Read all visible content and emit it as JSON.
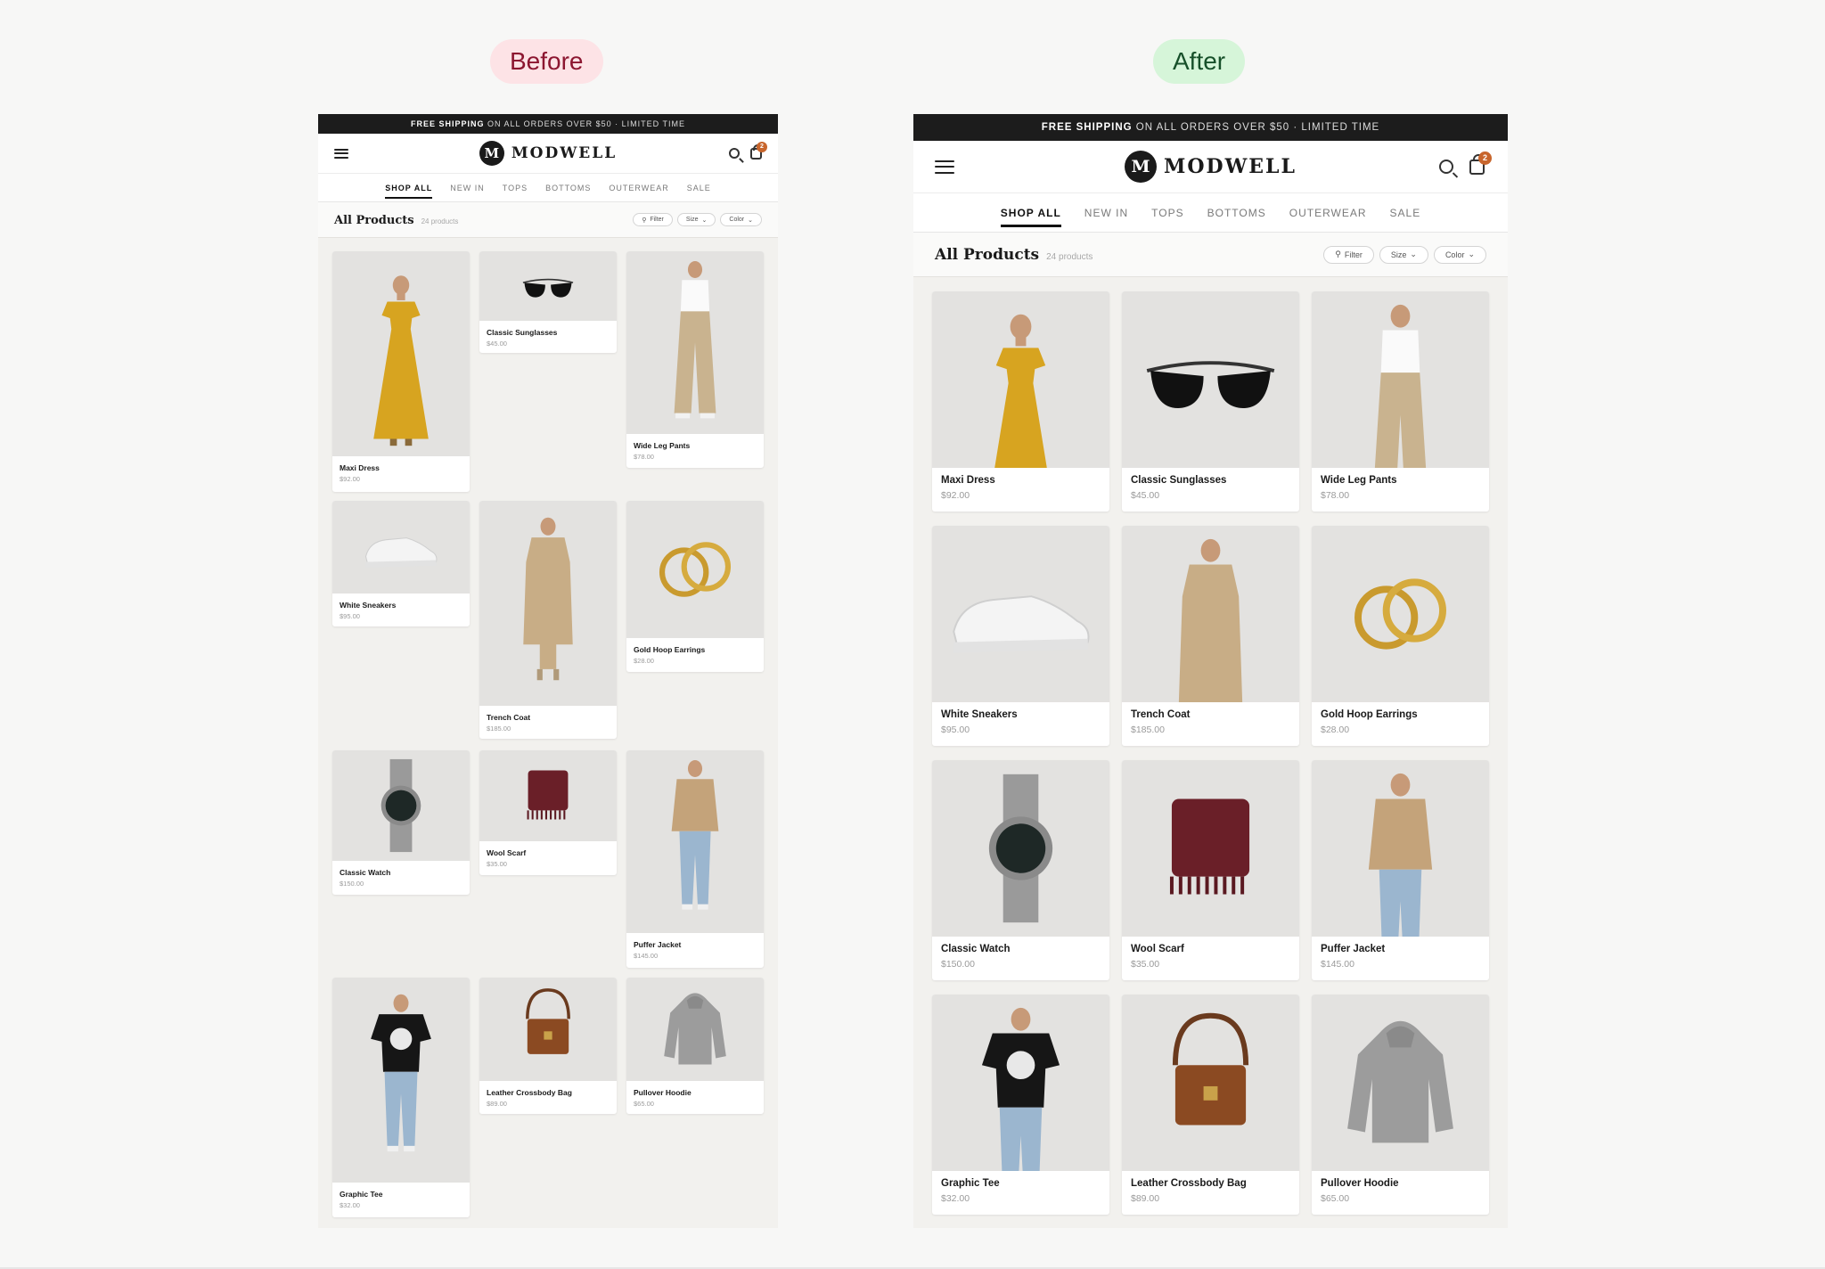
{
  "labels": {
    "before": "Before",
    "after": "After"
  },
  "app": {
    "shipping_strong": "FREE SHIPPING",
    "shipping_rest": " ON ALL ORDERS OVER $50 · LIMITED TIME",
    "logo_letter": "M",
    "logo_text": "MODWELL",
    "cart_count": "2",
    "nav": [
      "SHOP ALL",
      "NEW IN",
      "TOPS",
      "BOTTOMS",
      "OUTERWEAR",
      "SALE"
    ],
    "nav_active": "SHOP ALL",
    "title": "All Products",
    "count": "24 products",
    "chips": [
      "Filter",
      "Size",
      "Color"
    ]
  },
  "products": [
    {
      "name": "Maxi Dress",
      "price": "$92.00",
      "icon": "maxi-dress"
    },
    {
      "name": "Classic Sunglasses",
      "price": "$45.00",
      "icon": "sunglasses"
    },
    {
      "name": "Wide Leg Pants",
      "price": "$78.00",
      "icon": "wide-leg-pants"
    },
    {
      "name": "White Sneakers",
      "price": "$95.00",
      "icon": "sneakers"
    },
    {
      "name": "Trench Coat",
      "price": "$185.00",
      "icon": "trench-coat"
    },
    {
      "name": "Gold Hoop Earrings",
      "price": "$28.00",
      "icon": "hoop-earrings"
    },
    {
      "name": "Classic Watch",
      "price": "$150.00",
      "icon": "watch"
    },
    {
      "name": "Wool Scarf",
      "price": "$35.00",
      "icon": "scarf"
    },
    {
      "name": "Puffer Jacket",
      "price": "$145.00",
      "icon": "puffer-jacket"
    },
    {
      "name": "Graphic Tee",
      "price": "$32.00",
      "icon": "graphic-tee"
    },
    {
      "name": "Leather Crossbody Bag",
      "price": "$89.00",
      "icon": "crossbody-bag"
    },
    {
      "name": "Pullover Hoodie",
      "price": "$65.00",
      "icon": "hoodie"
    }
  ]
}
